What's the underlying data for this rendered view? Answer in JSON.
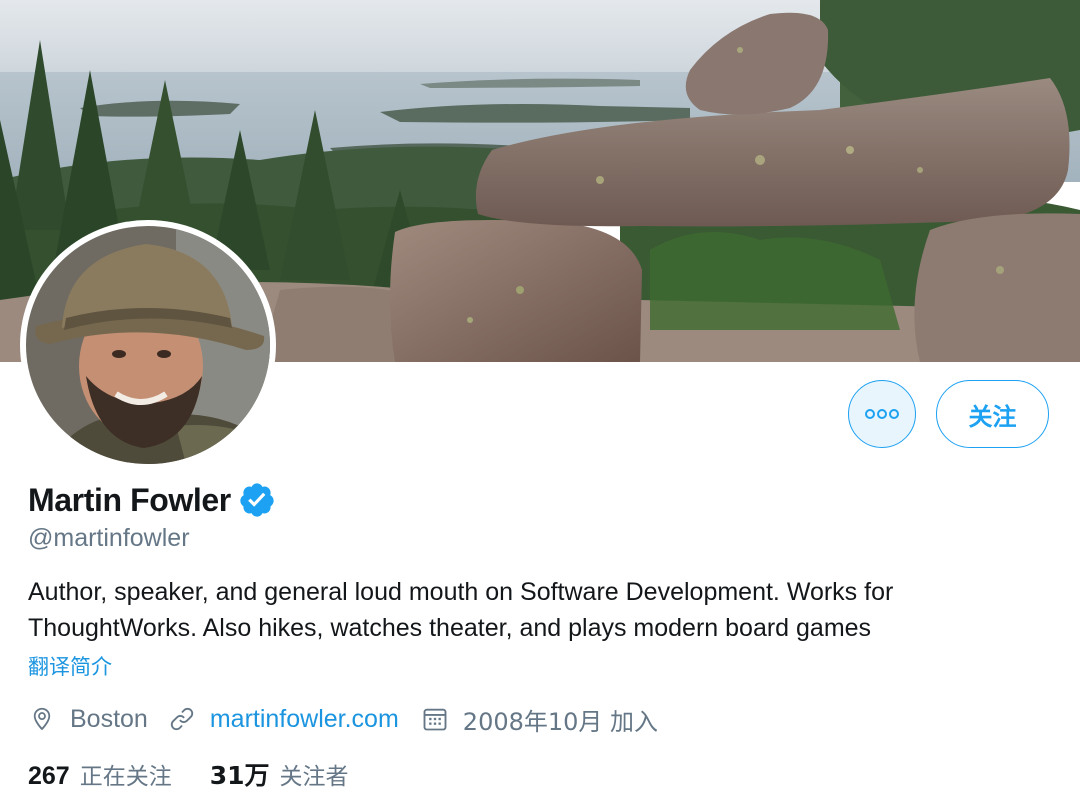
{
  "profile": {
    "display_name": "Martin Fowler",
    "verified": true,
    "handle": "@martinfowler",
    "bio": "Author, speaker, and general loud mouth on Software Development. Works for ThoughtWorks. Also hikes, watches theater, and plays modern board games",
    "translate_label": "翻译简介",
    "location": "Boston",
    "website": "martinfowler.com",
    "joined": "2008年10月 加入",
    "following_count": "267",
    "following_label": "正在关注",
    "followers_count": "31万",
    "followers_label": "关注者"
  },
  "actions": {
    "more_icon": "more-horizontal-icon",
    "follow_label": "关注"
  },
  "icons": {
    "location": "map-pin-icon",
    "website": "link-icon",
    "joined": "calendar-icon",
    "verified": "verified-badge-icon"
  },
  "colors": {
    "accent": "#1da1f2",
    "link": "#1b95e0",
    "text_primary": "#14171a",
    "text_secondary": "#657786",
    "more_button_bg": "#e8f5fd"
  }
}
